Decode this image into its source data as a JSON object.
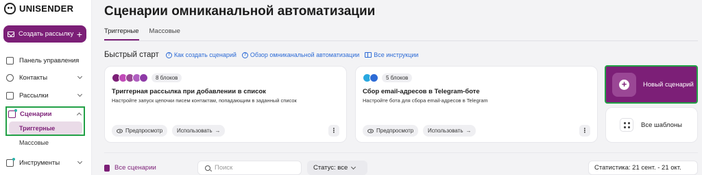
{
  "brand": {
    "name": "UNISENDER",
    "accent": "#7c1f77",
    "highlight": "#22a046"
  },
  "sidebar": {
    "create_button": "Создать рассылку",
    "items": [
      {
        "label": "Панель управления",
        "icon": "home-icon"
      },
      {
        "label": "Контакты",
        "icon": "contacts-icon"
      },
      {
        "label": "Рассылки",
        "icon": "mail-icon"
      },
      {
        "label": "Сценарии",
        "icon": "scenario-icon"
      },
      {
        "label": "Инструменты",
        "icon": "tools-icon"
      }
    ],
    "scenario_sub": [
      "Триггерные",
      "Массовые"
    ]
  },
  "page": {
    "title": "Сценарии омниканальной автоматизации",
    "tabs": [
      "Триггерные",
      "Массовые"
    ]
  },
  "quick_start": {
    "title": "Быстрый старт",
    "links": [
      "Как создать сценарий",
      "Обзор омниканальной автоматизации",
      "Все инструкции"
    ]
  },
  "cards": [
    {
      "blocks": "8 блоков",
      "title": "Триггерная рассылка при добавлении в список",
      "desc": "Настройте запуск цепочки писем контактам, попадающим в заданный список",
      "preview": "Предпросмотр",
      "use": "Использовать",
      "more": "⋮"
    },
    {
      "blocks": "5 блоков",
      "title": "Сбор email-адресов в Telegram-боте",
      "desc": "Настройте бота для сбора email-адресов в Telegram",
      "preview": "Предпросмотр",
      "use": "Использовать",
      "more": "⋮"
    }
  ],
  "new_scenario": "Новый сценарий",
  "all_templates": "Все шаблоны",
  "filter_bar": {
    "all_scenarios": "Все сценарии",
    "search_placeholder": "Поиск",
    "status": "Статус: все",
    "stats": "Статистика: 21 сент. - 21 окт."
  }
}
